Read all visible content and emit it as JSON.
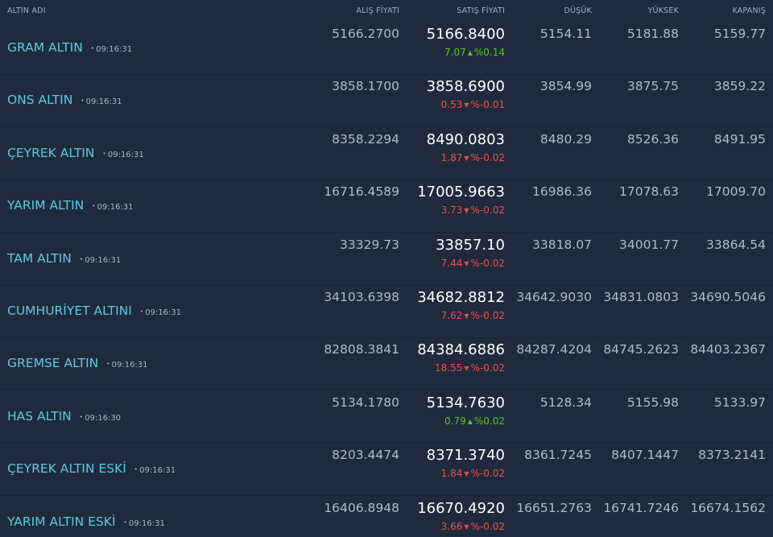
{
  "header": {
    "name": "ALTIN ADI",
    "buy": "ALIŞ FİYATI",
    "sell": "SATIŞ FİYATI",
    "low": "DÜŞÜK",
    "high": "YÜKSEK",
    "close": "KAPANIŞ"
  },
  "colors": {
    "background": "#1f2b3d",
    "name": "#5ec8e3",
    "up": "#54c42a",
    "down": "#ef4d4d"
  },
  "icons": {
    "up": "caret-up-icon",
    "down": "caret-down-icon"
  },
  "rows": [
    {
      "name": "GRAM ALTIN",
      "time": "09:16:31",
      "buy": "5166.2700",
      "sell": "5166.8400",
      "change": "7.07",
      "direction": "up",
      "percent": "%0.14",
      "low": "5154.11",
      "high": "5181.88",
      "close": "5159.77"
    },
    {
      "name": "ONS ALTIN",
      "time": "09:16:31",
      "buy": "3858.1700",
      "sell": "3858.6900",
      "change": "0.53",
      "direction": "down",
      "percent": "%-0.01",
      "low": "3854.99",
      "high": "3875.75",
      "close": "3859.22"
    },
    {
      "name": "ÇEYREK ALTIN",
      "time": "09:16:31",
      "buy": "8358.2294",
      "sell": "8490.0803",
      "change": "1.87",
      "direction": "down",
      "percent": "%-0.02",
      "low": "8480.29",
      "high": "8526.36",
      "close": "8491.95"
    },
    {
      "name": "YARIM ALTIN",
      "time": "09:16:31",
      "buy": "16716.4589",
      "sell": "17005.9663",
      "change": "3.73",
      "direction": "down",
      "percent": "%-0.02",
      "low": "16986.36",
      "high": "17078.63",
      "close": "17009.70"
    },
    {
      "name": "TAM ALTIN",
      "time": "09:16:31",
      "buy": "33329.73",
      "sell": "33857.10",
      "change": "7.44",
      "direction": "down",
      "percent": "%-0.02",
      "low": "33818.07",
      "high": "34001.77",
      "close": "33864.54"
    },
    {
      "name": "CUMHURİYET ALTINI",
      "time": "09:16:31",
      "buy": "34103.6398",
      "sell": "34682.8812",
      "change": "7.62",
      "direction": "down",
      "percent": "%-0.02",
      "low": "34642.9030",
      "high": "34831.0803",
      "close": "34690.5046"
    },
    {
      "name": "GREMSE ALTIN",
      "time": "09:16:31",
      "buy": "82808.3841",
      "sell": "84384.6886",
      "change": "18.55",
      "direction": "down",
      "percent": "%-0.02",
      "low": "84287.4204",
      "high": "84745.2623",
      "close": "84403.2367"
    },
    {
      "name": "HAS ALTIN",
      "time": "09:16:30",
      "buy": "5134.1780",
      "sell": "5134.7630",
      "change": "0.79",
      "direction": "up",
      "percent": "%0.02",
      "low": "5128.34",
      "high": "5155.98",
      "close": "5133.97"
    },
    {
      "name": "ÇEYREK ALTIN ESKİ",
      "time": "09:16:31",
      "buy": "8203.4474",
      "sell": "8371.3740",
      "change": "1.84",
      "direction": "down",
      "percent": "%-0.02",
      "low": "8361.7245",
      "high": "8407.1447",
      "close": "8373.2141"
    },
    {
      "name": "YARIM ALTIN ESKİ",
      "time": "09:16:31",
      "buy": "16406.8948",
      "sell": "16670.4920",
      "change": "3.66",
      "direction": "down",
      "percent": "%-0.02",
      "low": "16651.2763",
      "high": "16741.7246",
      "close": "16674.1562"
    }
  ]
}
